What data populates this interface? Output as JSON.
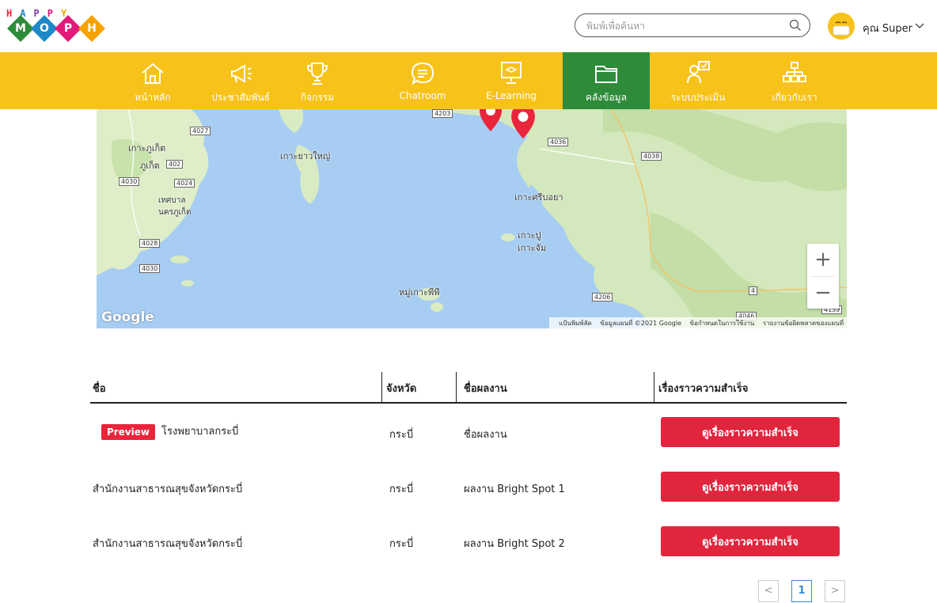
{
  "logo": {
    "top_letters": [
      "H",
      "A",
      "P",
      "P",
      "Y"
    ],
    "diamond_letters": [
      "M",
      "O",
      "P",
      "H"
    ],
    "top_colors": [
      "#e8253b",
      "#1e88c8",
      "#7b3bb0",
      "#e21b7a",
      "#f5a300"
    ],
    "diamond_colors": [
      "#2e8b3a",
      "#1e88c8",
      "#e21b7a",
      "#f5a300"
    ]
  },
  "search": {
    "placeholder": "พิมพ์เพื่อค้นหา"
  },
  "user": {
    "name": "คุณ Super"
  },
  "nav": {
    "items": [
      {
        "label": "หน้าหลัก",
        "icon": "home-icon"
      },
      {
        "label": "ประชาสัมพันธ์",
        "icon": "megaphone-icon"
      },
      {
        "label": "กิจกรรม",
        "icon": "trophy-icon"
      },
      {
        "label": "Chatroom",
        "icon": "chat-icon"
      },
      {
        "label": "E-Learning",
        "icon": "elearning-icon"
      },
      {
        "label": "คลังข้อมูล",
        "icon": "folder-icon",
        "active": true
      },
      {
        "label": "ระบบประเมิน",
        "icon": "assessment-icon"
      },
      {
        "label": "เกี่ยวกับเรา",
        "icon": "org-chart-icon"
      }
    ],
    "colors": {
      "bar": "#f7c21a",
      "active": "#2e8b3a"
    }
  },
  "map": {
    "labels": {
      "phuket_island": "เกาะภูเก็ต",
      "phuket": "ภูเก็ต",
      "phuket_city": "เทศบาล\nนครภูเก็ต",
      "yao_yai": "เกาะยาวใหญ่",
      "sriboya": "เกาะศรีบอยา",
      "pu": "เกาะปู",
      "jam": "เกาะจัม",
      "phiphi": "หมู่เกาะพีพี"
    },
    "roads": [
      "4027",
      "402",
      "4030",
      "4024",
      "4028",
      "4030",
      "4203",
      "4036",
      "4038",
      "4206",
      "4",
      "4159",
      "4046"
    ],
    "google": "Google",
    "attribution": [
      "แป้นพิมพ์ลัด",
      "ข้อมูลแผนที่ ©2021 Google",
      "ข้อกำหนดในการใช้งาน",
      "รายงานข้อผิดพลาดของแผนที่"
    ],
    "zoom_in": "+",
    "zoom_out": "−"
  },
  "table": {
    "headers": [
      "ชื่อ",
      "จังหวัด",
      "ชื่อผลงาน",
      "เรื่องราวความสำเร็จ"
    ],
    "rows": [
      {
        "preview": "Preview",
        "name": "โรงพยาบาลกระบี่",
        "province": "กระบี่",
        "work": "ชื่อผลงาน",
        "action": "ดูเรื่องราวความสำเร็จ"
      },
      {
        "preview": "",
        "name": "สำนักงานสาธารณสุขจังหวัดกระบี่",
        "province": "กระบี่",
        "work": "ผลงาน Bright Spot 1",
        "action": "ดูเรื่องราวความสำเร็จ"
      },
      {
        "preview": "",
        "name": "สำนักงานสาธารณสุขจังหวัดกระบี่",
        "province": "กระบี่",
        "work": "ผลงาน Bright Spot 2",
        "action": "ดูเรื่องราวความสำเร็จ"
      }
    ]
  },
  "pagination": {
    "prev": "<",
    "current": "1",
    "next": ">"
  }
}
